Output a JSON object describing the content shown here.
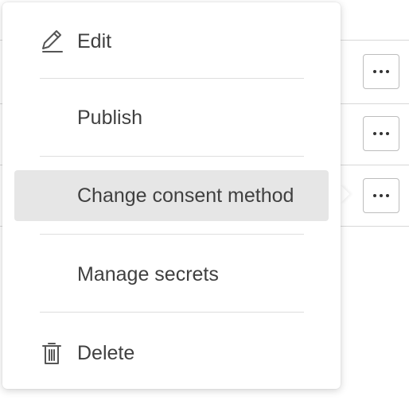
{
  "menu": {
    "items": [
      {
        "label": "Edit",
        "icon": "pencil-icon"
      },
      {
        "label": "Publish"
      },
      {
        "label": "Change consent method",
        "selected": true
      },
      {
        "label": "Manage secrets"
      },
      {
        "label": "Delete",
        "icon": "trash-icon"
      }
    ]
  },
  "background": {
    "row_actions": [
      {
        "icon": "more-horizontal-icon"
      },
      {
        "icon": "more-horizontal-icon"
      },
      {
        "icon": "more-horizontal-icon"
      }
    ]
  },
  "colors": {
    "selected_bg": "#e6e6e6",
    "text": "#404040",
    "border": "#bdbdbd"
  }
}
